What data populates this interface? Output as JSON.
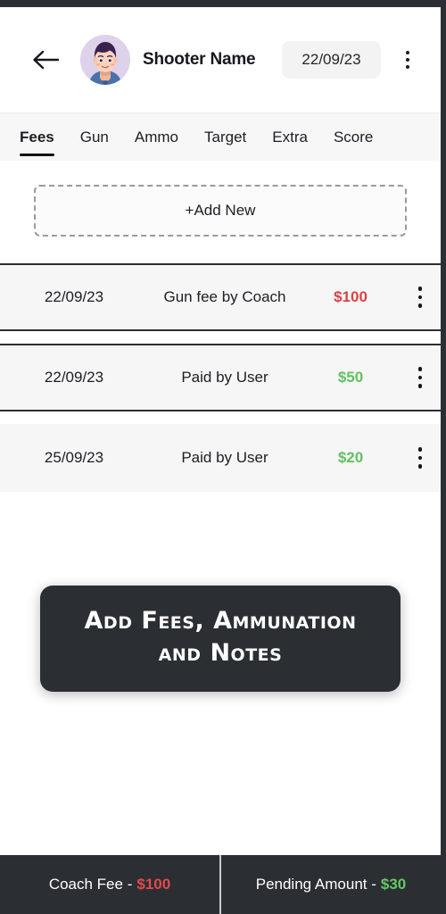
{
  "header": {
    "back_icon": "arrow-left-icon",
    "avatar_alt": "shooter-avatar",
    "shooter_name": "Shooter Name",
    "date": "22/09/23",
    "menu_icon": "kebab-menu-icon"
  },
  "tabs": [
    {
      "label": "Fees",
      "active": true
    },
    {
      "label": "Gun",
      "active": false
    },
    {
      "label": "Ammo",
      "active": false
    },
    {
      "label": "Target",
      "active": false
    },
    {
      "label": "Extra",
      "active": false
    },
    {
      "label": "Score",
      "active": false
    }
  ],
  "add_new": {
    "label": "+Add New"
  },
  "fee_rows": [
    {
      "date": "22/09/23",
      "description": "Gun fee by Coach",
      "amount": "$100",
      "type": "debit"
    },
    {
      "date": "22/09/23",
      "description": "Paid by User",
      "amount": "$50",
      "type": "credit"
    },
    {
      "date": "25/09/23",
      "description": "Paid by User",
      "amount": "$20",
      "type": "credit"
    }
  ],
  "coachmark": {
    "line1": "Add Fees, Ammunation",
    "line2": "and Notes"
  },
  "footer": {
    "coach_fee_label": "Coach Fee - ",
    "coach_fee_value": "$100",
    "pending_label": "Pending Amount - ",
    "pending_value": "$30"
  },
  "colors": {
    "debit": "#d94444",
    "credit": "#5fc25f",
    "frame": "#2b2e33",
    "tabbar": "#f7f7f7",
    "row": "#f6f6f6"
  }
}
